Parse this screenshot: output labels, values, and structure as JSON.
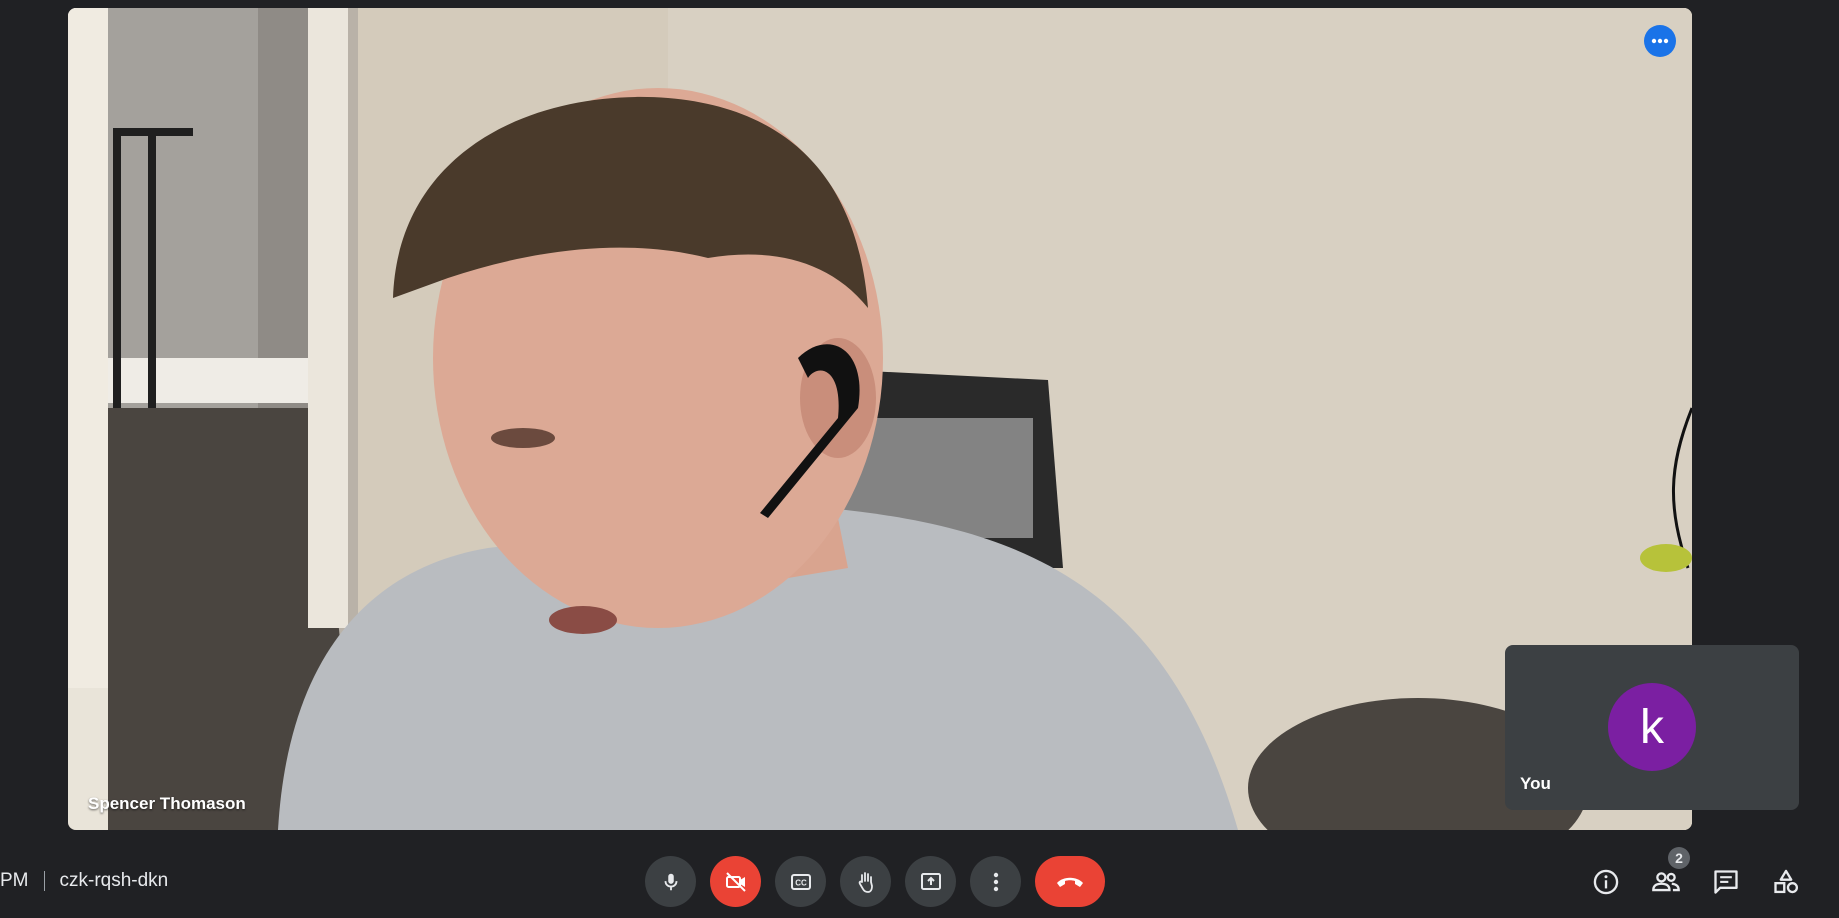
{
  "main_tile": {
    "participant_name": "Spencer Thomason"
  },
  "self_tile": {
    "avatar_letter": "k",
    "label": "You",
    "avatar_color": "#7b1fa2"
  },
  "meeting": {
    "time_fragment": "PM",
    "code": "czk-rqsh-dkn"
  },
  "controls": [
    {
      "name": "microphone",
      "icon": "microphone-icon",
      "state": "on"
    },
    {
      "name": "camera",
      "icon": "camera-off-icon",
      "state": "off"
    },
    {
      "name": "captions",
      "icon": "closed-captions-icon"
    },
    {
      "name": "raise-hand",
      "icon": "hand-icon"
    },
    {
      "name": "present",
      "icon": "present-screen-icon"
    },
    {
      "name": "more-options",
      "icon": "more-vertical-icon"
    },
    {
      "name": "leave-call",
      "icon": "hang-up-icon"
    }
  ],
  "right_panel": {
    "people_count": "2",
    "items": [
      {
        "name": "meeting-details",
        "icon": "info-icon"
      },
      {
        "name": "people",
        "icon": "people-icon"
      },
      {
        "name": "chat",
        "icon": "chat-icon"
      },
      {
        "name": "activities",
        "icon": "shapes-icon"
      }
    ]
  },
  "colors": {
    "background": "#202124",
    "button": "#3c4043",
    "danger": "#ea4335",
    "accent": "#1a73e8"
  }
}
